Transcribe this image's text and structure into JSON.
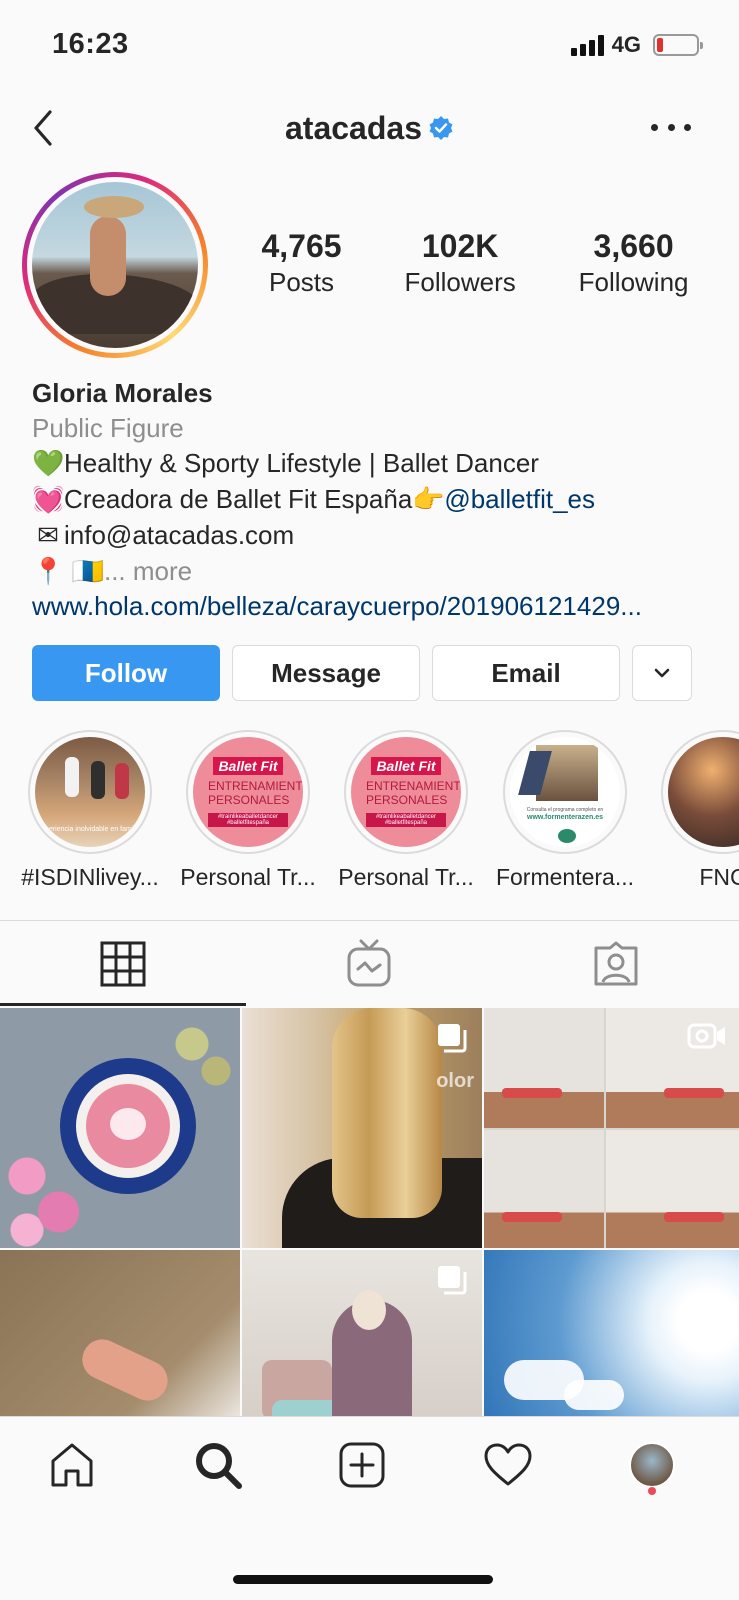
{
  "status_bar": {
    "time": "16:23",
    "network": "4G",
    "battery_level": 0.1
  },
  "header": {
    "username": "atacadas",
    "verified": true,
    "icons": [
      "back-chevron-icon",
      "verified-badge-icon",
      "more-options-icon"
    ]
  },
  "profile": {
    "stats": [
      {
        "value": "4,765",
        "label": "Posts"
      },
      {
        "value": "102K",
        "label": "Followers"
      },
      {
        "value": "3,660",
        "label": "Following"
      }
    ],
    "name": "Gloria Morales",
    "category": "Public Figure",
    "bio": {
      "line1_emoji": "💚",
      "line1_text": "Healthy & Sporty Lifestyle | Ballet Dancer",
      "line2_emoji": "💓",
      "line2_text": "Creadora de Ballet Fit España",
      "line2_pointer": "👉",
      "line2_mention": "@balletfit_es",
      "line3_emoji": "✉",
      "line3_text": "info@atacadas.com",
      "line4_emoji": "📍 🇮🇨",
      "line4_more": "... more",
      "link": "www.hola.com/belleza/caraycuerpo/201906121429..."
    }
  },
  "actions": {
    "follow": "Follow",
    "message": "Message",
    "email": "Email"
  },
  "highlights": [
    {
      "label": "#ISDINlivey...",
      "overlay": "periencia inolvidable en famil"
    },
    {
      "label": "Personal Tr...",
      "tag": "Ballet Fit",
      "sub": "ENTRENAMIENTOS PERSONALES",
      "hash": "#trainlikeaballetdancer #balletfitespaña"
    },
    {
      "label": "Personal Tr...",
      "tag": "Ballet Fit",
      "sub": "ENTRENAMIENTOS PERSONALES",
      "hash": "#trainlikeaballetdancer #balletfitespaña"
    },
    {
      "label": "Formentera...",
      "caption": "Consulta el programa completo en",
      "url": "www.formenterazen.es"
    },
    {
      "label": "FNC"
    }
  ],
  "tabs": [
    {
      "name": "grid",
      "icon": "grid-icon",
      "active": true
    },
    {
      "name": "igtv",
      "icon": "igtv-icon",
      "active": false
    },
    {
      "name": "tagged",
      "icon": "tagged-icon",
      "active": false
    }
  ],
  "posts": [
    {
      "subject": "latte art with flowers",
      "badge": ""
    },
    {
      "subject": "wavy blonde hair",
      "badge": "carousel-icon",
      "overlay_text": "olor"
    },
    {
      "subject": "exercise collage",
      "badge": "video-icon"
    },
    {
      "subject": "beach sand feet",
      "badge": ""
    },
    {
      "subject": "woman stretching in bed",
      "badge": "carousel-icon"
    },
    {
      "subject": "sunny sky with clouds",
      "badge": ""
    }
  ],
  "bottom_nav": [
    "home-icon",
    "search-icon",
    "new-post-icon",
    "activity-heart-icon",
    "profile-avatar"
  ],
  "colors": {
    "accent_blue": "#3897f0",
    "link_blue": "#00376b",
    "muted": "#8e8e8e",
    "notification_red": "#ed4956"
  }
}
